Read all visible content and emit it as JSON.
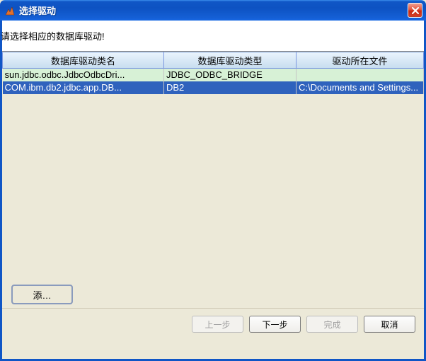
{
  "window": {
    "title": "选择驱动"
  },
  "instruction": "请选择相应的数据库驱动!",
  "table": {
    "headers": {
      "col1": "数据库驱动类名",
      "col2": "数据库驱动类型",
      "col3": "驱动所在文件"
    },
    "rows": [
      {
        "class_name": "sun.jdbc.odbc.JdbcOdbcDri...",
        "type": "JDBC_ODBC_BRIDGE",
        "file": ""
      },
      {
        "class_name": "COM.ibm.db2.jdbc.app.DB...",
        "type": "DB2",
        "file": "C:\\Documents and Settings..."
      }
    ]
  },
  "buttons": {
    "add": "添…",
    "back": "上一步",
    "next": "下一步",
    "finish": "完成",
    "cancel": "取消"
  }
}
